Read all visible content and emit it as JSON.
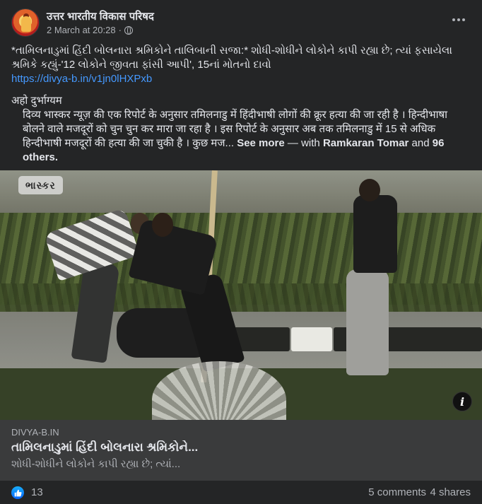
{
  "header": {
    "page_name": "उत्तर भारतीय विकास परिषद",
    "timestamp": "2 March at 20:28",
    "separator": "·",
    "privacy_icon": "globe-icon",
    "more_icon": "more-options-icon"
  },
  "post": {
    "line1": "*તામિલનાડુમાં હિંદી બોલનારા શ્રમિકોને તાલિબાની સજા:* શોધી-શોધીને લોકોને કાપી રહ્યા છે; ત્યાં ફસાયેલા શ્રમિકે કહ્યું-'12 લોકોને જીવતા ફાંસી આપી', 15નાં મોતનો દાવો",
    "link_url": "https://divya-b.in/v1jn0lHXPxb",
    "line3": "अहो दुर्भाग्यम",
    "line4": "दिव्य भास्कर न्यूज़ की एक रिपोर्ट के अनुसार तमिलनाडु में हिंदीभाषी लोगों की क्रूर हत्या की जा रही है । हिन्दीभाषा बोलने वाले मजदूरों को चुन चुन कर मारा जा रहा है । इस रिपोर्ट के अनुसार अब तक तमिलनाडु में 15 से अधिक हिन्दीभाषी मजदूरों की हत्या की जा चुकी है । कुछ मज...",
    "see_more": "See more",
    "with_text": "— with",
    "with_user": "Ramkaran Tomar",
    "and_text": "and",
    "others": "96 others."
  },
  "media": {
    "watermark": "ભાસ્કર",
    "info_label": "i"
  },
  "link_preview": {
    "domain": "DIVYA-B.IN",
    "title": "તામિલનાડુમાં હિંદી બોલનારા શ્રમિકોને...",
    "description": "શોધી-શોધીને લોકોને કાપી રહ્યા છે; ત્યાં..."
  },
  "footer": {
    "reaction_icon": "like-reaction-icon",
    "like_count": "13",
    "comments": "5 comments",
    "shares": "4 shares"
  },
  "colors": {
    "background": "#242526",
    "card": "#3a3b3c",
    "text_primary": "#e4e6eb",
    "text_secondary": "#b0b3b8",
    "link": "#4599ff",
    "like_blue": "#0866ff"
  }
}
